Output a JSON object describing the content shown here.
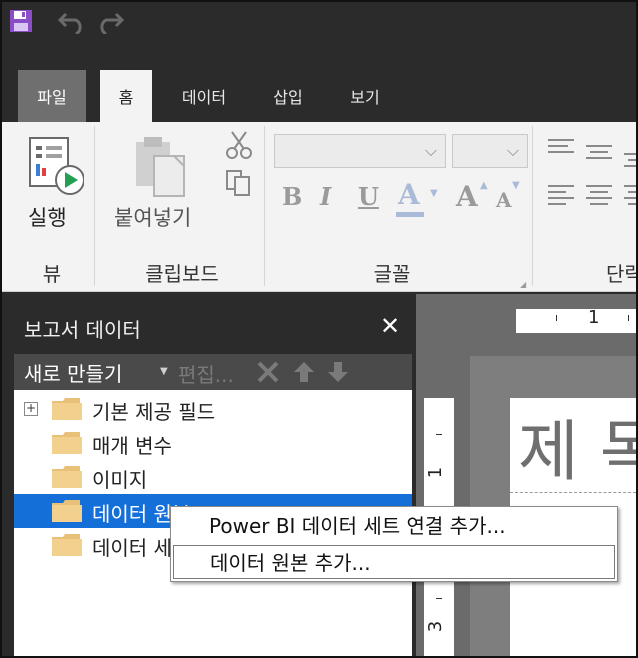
{
  "tabs": [
    {
      "label": "파일"
    },
    {
      "label": "홈"
    },
    {
      "label": "데이터"
    },
    {
      "label": "삽입"
    },
    {
      "label": "보기"
    }
  ],
  "ribbon": {
    "run_label": "실행",
    "paste_label": "붙여넣기",
    "groups": {
      "view": "뷰",
      "clipboard": "클립보드",
      "font": "글꼴",
      "paragraph": "단락"
    },
    "format_glyphs": {
      "bold": "B",
      "italic": "I",
      "underline": "U",
      "font_color": "A",
      "grow": "A",
      "shrink": "A"
    }
  },
  "panel": {
    "title": "보고서 데이터",
    "toolbar": {
      "new_label": "새로 만들기",
      "edit_label": "편집..."
    },
    "tree": [
      {
        "label": "기본 제공 필드",
        "expandable": true
      },
      {
        "label": "매개 변수"
      },
      {
        "label": "이미지"
      },
      {
        "label": "데이터 원본",
        "selected": true
      },
      {
        "label": "데이터 세트"
      }
    ]
  },
  "canvas": {
    "ruler_top_mark": "1",
    "ruler_left_marks": [
      "1",
      "3"
    ],
    "page_title": "제 목"
  },
  "context_menu": {
    "items": [
      {
        "label": "Power BI 데이터 세트 연결 추가..."
      },
      {
        "label": "데이터 원본 추가..."
      }
    ]
  },
  "colors": {
    "selection": "#1470d8",
    "dark_bg": "#2b2b2b",
    "ribbon_bg": "#f3f3f3",
    "save_icon": "#8a4fc8"
  }
}
